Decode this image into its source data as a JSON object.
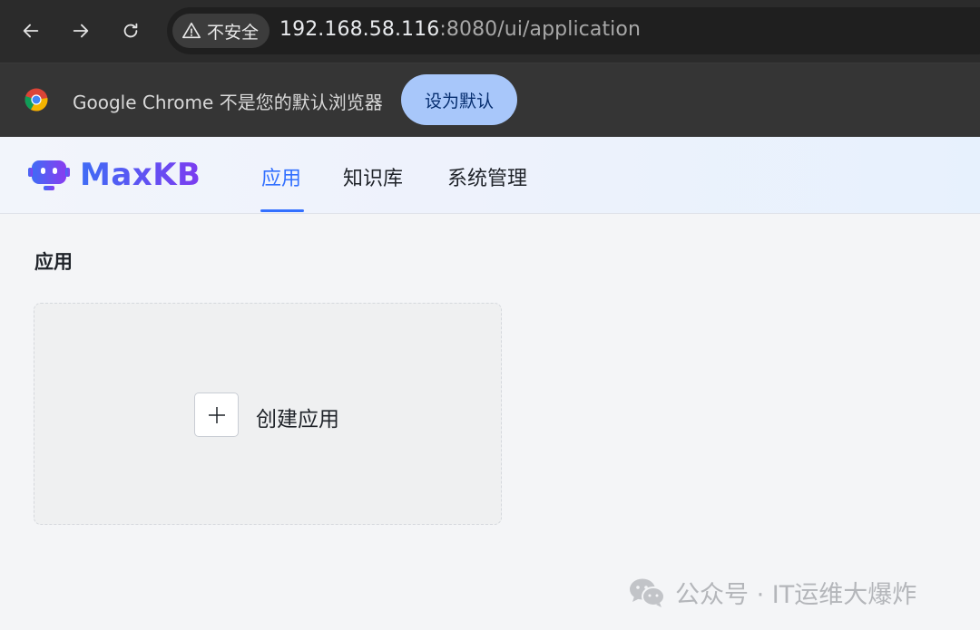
{
  "browser": {
    "security_label": "不安全",
    "url_host": "192.168.58.116",
    "url_rest": ":8080/ui/application",
    "icons": {
      "back": "arrow-left-icon",
      "forward": "arrow-right-icon",
      "reload": "reload-icon",
      "security": "warning-triangle-icon"
    }
  },
  "infobar": {
    "message": "Google Chrome 不是您的默认浏览器",
    "button_label": "设为默认",
    "button_color": "#a8c7fa"
  },
  "app": {
    "logo_text": "MaxKB",
    "accent_color": "#3370ff",
    "nav_tabs": [
      {
        "label": "应用",
        "active": true
      },
      {
        "label": "知识库",
        "active": false
      },
      {
        "label": "系统管理",
        "active": false
      }
    ]
  },
  "main": {
    "page_title": "应用",
    "create_card_label": "创建应用"
  },
  "watermark": {
    "text": "公众号 · IT运维大爆炸"
  }
}
